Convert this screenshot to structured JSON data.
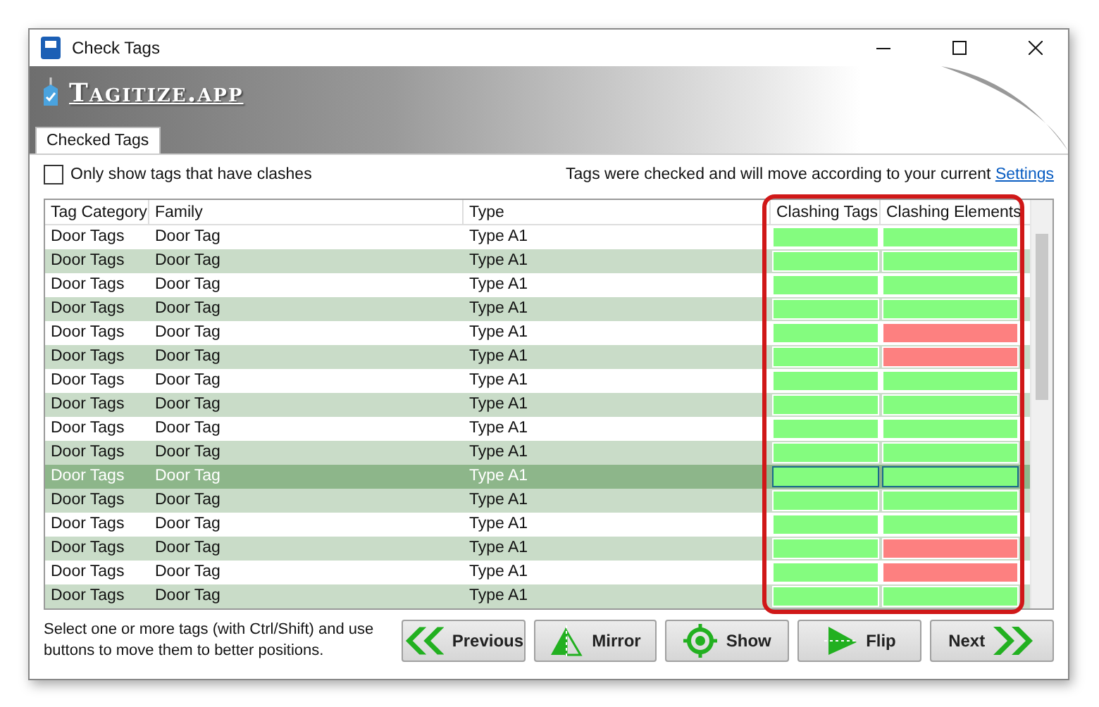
{
  "window": {
    "title": "Check Tags"
  },
  "banner": {
    "logo_text": "Tagitize.app"
  },
  "tabs": [
    {
      "label": "Checked Tags",
      "selected": true
    }
  ],
  "filter": {
    "label": "Only show tags that have clashes",
    "checked": false
  },
  "notice": {
    "text": "Tags were checked and will move according to your current",
    "link": "Settings"
  },
  "table": {
    "columns": [
      "Tag Category",
      "Family",
      "Type",
      "Clashing Tags",
      "Clashing Elements"
    ],
    "rows": [
      {
        "category": "Door Tags",
        "family": "Door Tag",
        "type": "Type A1",
        "selected": false,
        "clashing_tags": false,
        "clashing_elements": false
      },
      {
        "category": "Door Tags",
        "family": "Door Tag",
        "type": "Type A1",
        "selected": false,
        "clashing_tags": false,
        "clashing_elements": false
      },
      {
        "category": "Door Tags",
        "family": "Door Tag",
        "type": "Type A1",
        "selected": false,
        "clashing_tags": false,
        "clashing_elements": false
      },
      {
        "category": "Door Tags",
        "family": "Door Tag",
        "type": "Type A1",
        "selected": false,
        "clashing_tags": false,
        "clashing_elements": false
      },
      {
        "category": "Door Tags",
        "family": "Door Tag",
        "type": "Type A1",
        "selected": false,
        "clashing_tags": false,
        "clashing_elements": true
      },
      {
        "category": "Door Tags",
        "family": "Door Tag",
        "type": "Type A1",
        "selected": false,
        "clashing_tags": false,
        "clashing_elements": true
      },
      {
        "category": "Door Tags",
        "family": "Door Tag",
        "type": "Type A1",
        "selected": false,
        "clashing_tags": false,
        "clashing_elements": false
      },
      {
        "category": "Door Tags",
        "family": "Door Tag",
        "type": "Type A1",
        "selected": false,
        "clashing_tags": false,
        "clashing_elements": false
      },
      {
        "category": "Door Tags",
        "family": "Door Tag",
        "type": "Type A1",
        "selected": false,
        "clashing_tags": false,
        "clashing_elements": false
      },
      {
        "category": "Door Tags",
        "family": "Door Tag",
        "type": "Type A1",
        "selected": false,
        "clashing_tags": false,
        "clashing_elements": false
      },
      {
        "category": "Door Tags",
        "family": "Door Tag",
        "type": "Type A1",
        "selected": true,
        "clashing_tags": false,
        "clashing_elements": false
      },
      {
        "category": "Door Tags",
        "family": "Door Tag",
        "type": "Type A1",
        "selected": false,
        "clashing_tags": false,
        "clashing_elements": false
      },
      {
        "category": "Door Tags",
        "family": "Door Tag",
        "type": "Type A1",
        "selected": false,
        "clashing_tags": false,
        "clashing_elements": false
      },
      {
        "category": "Door Tags",
        "family": "Door Tag",
        "type": "Type A1",
        "selected": false,
        "clashing_tags": false,
        "clashing_elements": true
      },
      {
        "category": "Door Tags",
        "family": "Door Tag",
        "type": "Type A1",
        "selected": false,
        "clashing_tags": false,
        "clashing_elements": true
      },
      {
        "category": "Door Tags",
        "family": "Door Tag",
        "type": "Type A1",
        "selected": false,
        "clashing_tags": false,
        "clashing_elements": false
      }
    ]
  },
  "hint": "Select one or more tags (with Ctrl/Shift) and use buttons to move them to better positions.",
  "buttons": [
    {
      "kind": "previous",
      "label": "Previous"
    },
    {
      "kind": "mirror",
      "label": "Mirror"
    },
    {
      "kind": "show",
      "label": "Show"
    },
    {
      "kind": "flip",
      "label": "Flip"
    },
    {
      "kind": "next",
      "label": "Next"
    }
  ]
}
